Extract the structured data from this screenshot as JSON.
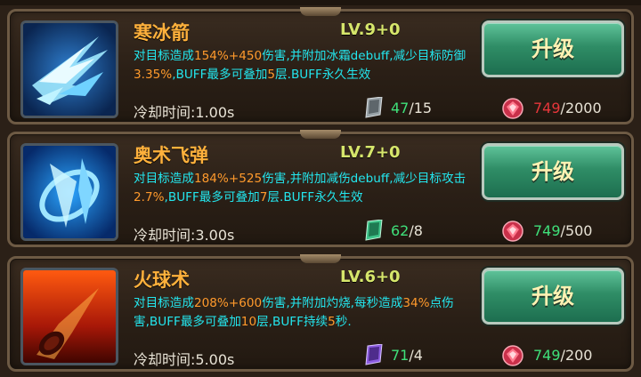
{
  "skills": [
    {
      "name": "寒冰箭",
      "level": "LV.9+0",
      "desc": [
        {
          "t": "对目标造成",
          "h": false
        },
        {
          "t": "154%",
          "h": true
        },
        {
          "t": "+450",
          "h": true
        },
        {
          "t": "伤害,并附加冰霜debuff,减少目标防御",
          "h": false
        },
        {
          "t": "3.35%",
          "h": true
        },
        {
          "t": ",BUFF最多可叠加",
          "h": false
        },
        {
          "t": "5",
          "h": true
        },
        {
          "t": "层.BUFF永久生效",
          "h": false
        }
      ],
      "cooldown": "冷却时间:1.00s",
      "books_have": "47",
      "books_need": "/15",
      "book_icon": "grey-skill-book-icon",
      "book_color": "#9aa3a8",
      "cost_have": "749",
      "cost_need": "/2000",
      "cost_sufficient": false,
      "upgrade_label": "升级",
      "icon": "ice-arrow-skill-icon"
    },
    {
      "name": "奥术飞弹",
      "level": "LV.7+0",
      "desc": [
        {
          "t": "对目标造成",
          "h": false
        },
        {
          "t": "184%",
          "h": true
        },
        {
          "t": "+525",
          "h": true
        },
        {
          "t": "伤害,并附加减伤debuff,减少目标攻击",
          "h": false
        },
        {
          "t": "2.7%",
          "h": true
        },
        {
          "t": ",BUFF最多可叠加",
          "h": false
        },
        {
          "t": "7",
          "h": true
        },
        {
          "t": "层.BUFF永久生效",
          "h": false
        }
      ],
      "cooldown": "冷却时间:3.00s",
      "books_have": "62",
      "books_need": "/8",
      "book_icon": "green-skill-book-icon",
      "book_color": "#3ec58a",
      "cost_have": "749",
      "cost_need": "/500",
      "cost_sufficient": true,
      "upgrade_label": "升级",
      "icon": "arcane-missile-skill-icon"
    },
    {
      "name": "火球术",
      "level": "LV.6+0",
      "desc": [
        {
          "t": "对目标造成",
          "h": false
        },
        {
          "t": "208%",
          "h": true
        },
        {
          "t": "+600",
          "h": true
        },
        {
          "t": "伤害,并附加灼烧,每秒造成",
          "h": false
        },
        {
          "t": "34%",
          "h": true
        },
        {
          "t": "点伤害,BUFF最多可叠加",
          "h": false
        },
        {
          "t": "10",
          "h": true
        },
        {
          "t": "层,BUFF持续",
          "h": false
        },
        {
          "t": "5",
          "h": true
        },
        {
          "t": "秒.",
          "h": false
        }
      ],
      "cooldown": "冷却时间:5.00s",
      "books_have": "71",
      "books_need": "/4",
      "book_icon": "purple-skill-book-icon",
      "book_color": "#8c5ce0",
      "cost_have": "749",
      "cost_need": "/200",
      "cost_sufficient": true,
      "upgrade_label": "升级",
      "icon": "fireball-skill-icon"
    }
  ],
  "colors": {
    "highlight": "#ff9a2c",
    "desc_text": "#23e6ee",
    "name_text": "#ffb13c",
    "level_text": "#d6e66b",
    "insufficient": "#e6363a",
    "sufficient": "#3fe07a"
  }
}
